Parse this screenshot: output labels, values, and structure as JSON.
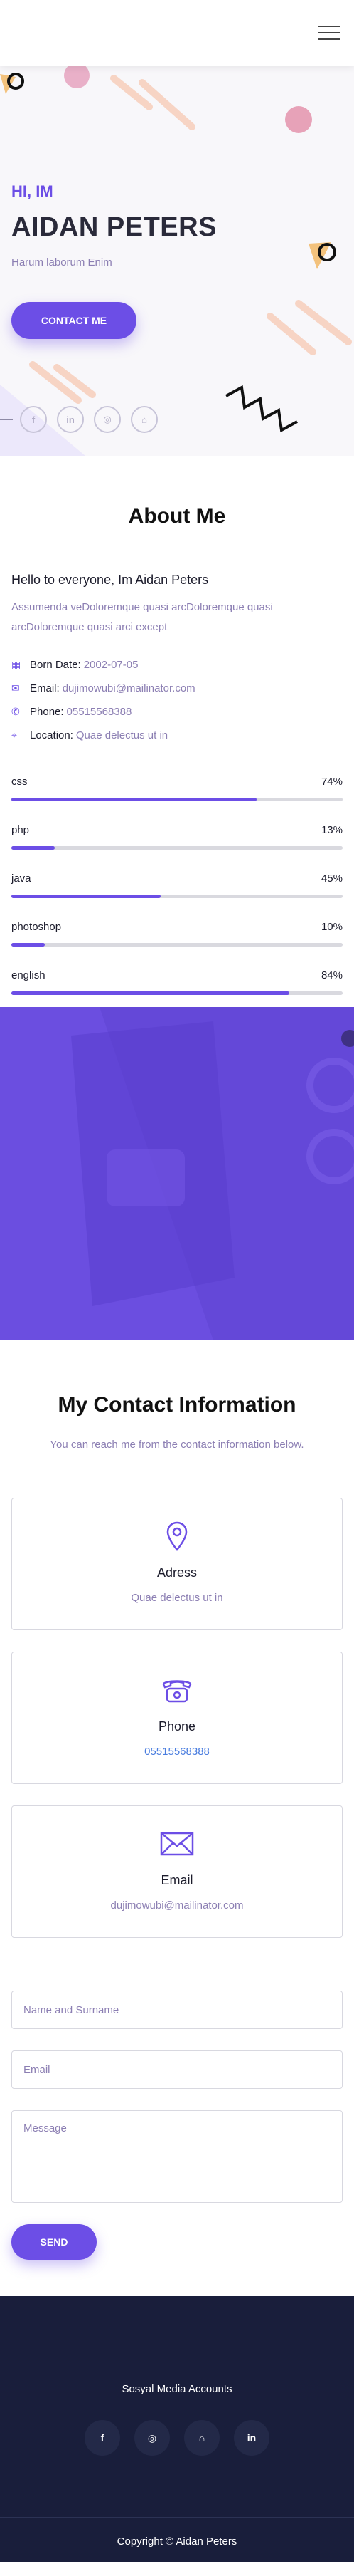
{
  "hero": {
    "greeting": "HI, IM",
    "name": "AIDAN PETERS",
    "subtitle": "Harum laborum Enim",
    "contact_button": "CONTACT ME",
    "social": [
      "facebook-icon",
      "linkedin-icon",
      "instagram-icon",
      "github-icon"
    ]
  },
  "about": {
    "title": "About Me",
    "heading": "Hello to everyone, Im Aidan Peters",
    "text": "Assumenda veDoloremque quasi arcDoloremque quasi arcDoloremque quasi arci except",
    "info": [
      {
        "icon": "calendar-icon",
        "label": "Born Date:",
        "value": "2002-07-05"
      },
      {
        "icon": "mail-icon",
        "label": "Email:",
        "value": "dujimowubi@mailinator.com"
      },
      {
        "icon": "phone-icon",
        "label": "Phone:",
        "value": "05515568388"
      },
      {
        "icon": "location-icon",
        "label": "Location:",
        "value": "Quae delectus ut in"
      }
    ],
    "skills": [
      {
        "name": "css",
        "percent": 74,
        "label": "74%"
      },
      {
        "name": "php",
        "percent": 13,
        "label": "13%"
      },
      {
        "name": "java",
        "percent": 45,
        "label": "45%"
      },
      {
        "name": "photoshop",
        "percent": 10,
        "label": "10%"
      },
      {
        "name": "english",
        "percent": 84,
        "label": "84%"
      }
    ]
  },
  "contact": {
    "title": "My Contact Information",
    "subtitle": "You can reach me from the contact information below.",
    "cards": [
      {
        "icon": "location-pin-icon",
        "title": "Adress",
        "value": "Quae delectus ut in"
      },
      {
        "icon": "telephone-icon",
        "title": "Phone",
        "value": "05515568388"
      },
      {
        "icon": "envelope-icon",
        "title": "Email",
        "value": "dujimowubi@mailinator.com"
      }
    ],
    "form": {
      "name_placeholder": "Name and Surname",
      "email_placeholder": "Email",
      "message_placeholder": "Message",
      "send_label": "SEND"
    }
  },
  "footer": {
    "social_title": "Sosyal Media Accounts",
    "social": [
      "facebook-icon",
      "instagram-icon",
      "github-icon",
      "linkedin-icon"
    ],
    "copyright": "Copyright © Aidan Peters"
  },
  "colors": {
    "accent": "#6c4ee6",
    "footer_bg": "#191e3b",
    "muted_text": "#8c7fb3"
  }
}
